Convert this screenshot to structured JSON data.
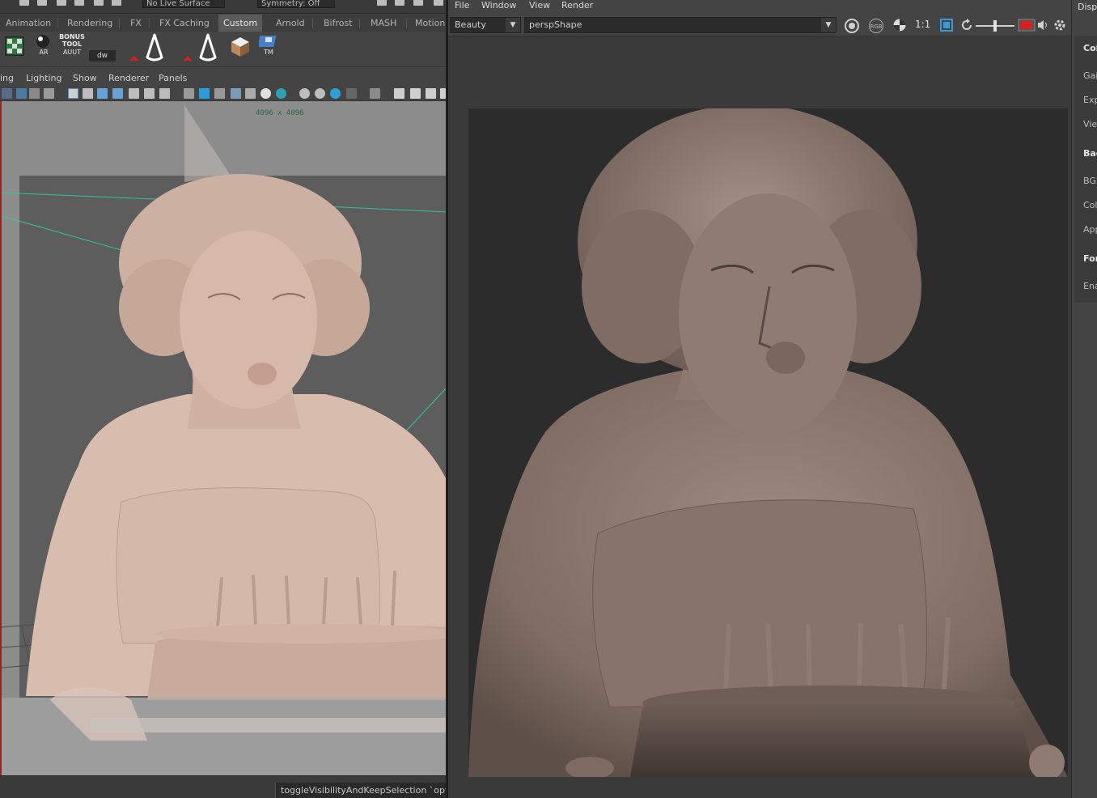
{
  "left_panel": {
    "top_strip": {
      "live_surface_field": "No Live Surface",
      "symmetry_field": "Symmetry: Off"
    },
    "shelf_tabs": [
      "Animation",
      "Rendering",
      "FX",
      "FX Caching",
      "Custom",
      "Arnold",
      "Bifrost",
      "MASH",
      "Motion"
    ],
    "active_tab": "Custom",
    "shelf": {
      "bonus_tool_label": "BONUS\nTOOL",
      "ar_label": "AR",
      "auut_label": "AUUT",
      "dw_label": "dw",
      "tm_label": "TM"
    },
    "panel_menu": [
      "ing",
      "Lighting",
      "Show",
      "Renderer",
      "Panels"
    ],
    "viewport": {
      "resolution_label": "4096 x 4096"
    },
    "command_field": "toggleVisibilityAndKeepSelection `optio"
  },
  "render_view": {
    "menu": [
      "File",
      "Window",
      "View",
      "Render"
    ],
    "aov_dropdown": "Beauty",
    "camera_dropdown": "perspShape",
    "ratio_label": "1:1",
    "rgb_label": "RGB"
  },
  "attribute_panel": {
    "header": "Disp",
    "items": [
      {
        "label": "Col",
        "bold": true
      },
      {
        "label": "Gai",
        "bold": false
      },
      {
        "label": "Exp",
        "bold": false
      },
      {
        "label": "Vie",
        "bold": false
      },
      {
        "label": "Bac",
        "bold": true
      },
      {
        "label": "BG",
        "bold": false
      },
      {
        "label": "Col",
        "bold": false
      },
      {
        "label": "App",
        "bold": false
      },
      {
        "label": "For",
        "bold": true
      },
      {
        "label": "Ena",
        "bold": false
      }
    ]
  },
  "colors": {
    "accent_red": "#a02020",
    "viewport_bg": "#5d5d5d",
    "model_clay": "#d8b8a8",
    "render_clay": "#8d7a70",
    "camera_line": "#2ec6a0"
  }
}
